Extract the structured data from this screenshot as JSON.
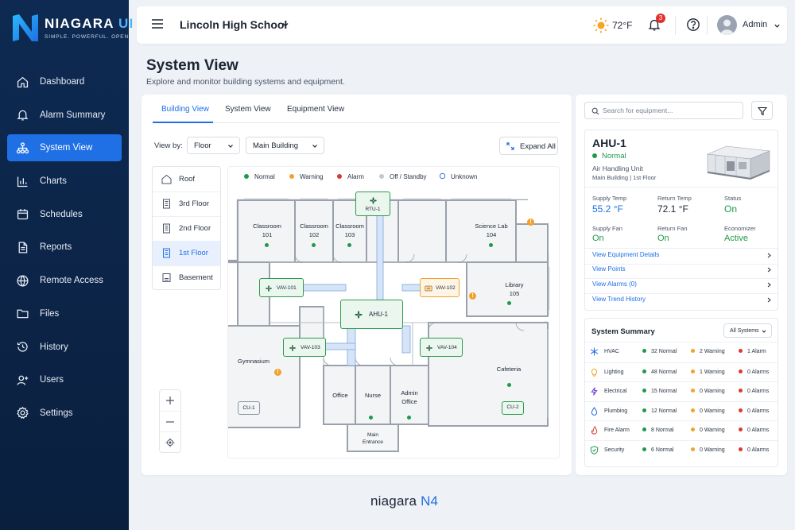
{
  "brand": {
    "name": "NIAGARA",
    "name_accent": "UI",
    "tagline": "SIMPLE. POWERFUL. OPEN."
  },
  "sidebar": {
    "items": [
      {
        "label": "Dashboard",
        "icon": "home-icon"
      },
      {
        "label": "Alarm Summary",
        "icon": "bell-icon"
      },
      {
        "label": "System View",
        "icon": "hierarchy-icon",
        "active": true
      },
      {
        "label": "Charts",
        "icon": "bar-chart-icon"
      },
      {
        "label": "Schedules",
        "icon": "calendar-icon"
      },
      {
        "label": "Reports",
        "icon": "document-icon"
      },
      {
        "label": "Remote Access",
        "icon": "globe-icon"
      },
      {
        "label": "Files",
        "icon": "folder-icon"
      },
      {
        "label": "History",
        "icon": "history-icon"
      },
      {
        "label": "Users",
        "icon": "add-user-icon"
      },
      {
        "label": "Settings",
        "icon": "gear-icon"
      }
    ]
  },
  "topbar": {
    "site": "Lincoln High School",
    "temperature": "72°F",
    "notifications": "3",
    "user": "Admin"
  },
  "page": {
    "title": "System View",
    "subtitle": "Explore and monitor building systems and equipment."
  },
  "tabs": [
    "Building View",
    "System View",
    "Equipment View"
  ],
  "controls": {
    "view_by_label": "View by:",
    "view_by_value": "Floor",
    "building_value": "Main Building",
    "expand_label": "Expand All"
  },
  "floors": [
    "Roof",
    "3rd Floor",
    "2nd Floor",
    "1st Floor",
    "Basement"
  ],
  "legend": [
    {
      "label": "Normal",
      "color": "#1e9a4a"
    },
    {
      "label": "Warning",
      "color": "#f2a22c"
    },
    {
      "label": "Alarm",
      "color": "#d93a2f"
    },
    {
      "label": "Off / Standby",
      "color": "#c2c7cf"
    },
    {
      "label": "Unknown",
      "color": "#2f6fd6"
    }
  ],
  "plan": {
    "rooms": [
      {
        "name": "Classroom",
        "num": "101"
      },
      {
        "name": "Classroom",
        "num": "102"
      },
      {
        "name": "Classroom",
        "num": "103"
      },
      {
        "name": "Science Lab",
        "num": "104"
      },
      {
        "name": "Library",
        "num": "105"
      },
      {
        "name": "Gymnasium",
        "num": ""
      },
      {
        "name": "Office",
        "num": ""
      },
      {
        "name": "Nurse",
        "num": ""
      },
      {
        "name": "Admin",
        "num": "Office"
      },
      {
        "name": "Cafeteria",
        "num": ""
      },
      {
        "name": "Main",
        "num": "Entrance"
      }
    ],
    "equipment": [
      "RTU-1",
      "VAV-101",
      "VAV-102",
      "AHU-1",
      "VAV-103",
      "VAV-104",
      "CU-1",
      "CU-2"
    ]
  },
  "search": {
    "placeholder": "Search for equipment..."
  },
  "equipment": {
    "name": "AHU-1",
    "status": "Normal",
    "type": "Air Handling Unit",
    "location": "Main Building  |  1st Floor",
    "metrics": [
      {
        "label": "Supply Temp",
        "value": "55.2 °F"
      },
      {
        "label": "Return Temp",
        "value": "72.1 °F"
      },
      {
        "label": "Status",
        "value": "On"
      },
      {
        "label": "Supply Fan",
        "value": "On"
      },
      {
        "label": "Return Fan",
        "value": "On"
      },
      {
        "label": "Economizer",
        "value": "Active"
      }
    ],
    "links": [
      "View Equipment Details",
      "View Points",
      "View Alarms (0)",
      "View Trend History"
    ]
  },
  "summary": {
    "title": "System Summary",
    "filter": "All Systems",
    "rows": [
      {
        "system": "HVAC",
        "icon": "snowflake-icon",
        "normal": "32 Normal",
        "warning": "2 Warning",
        "alarm": "1 Alarm"
      },
      {
        "system": "Lighting",
        "icon": "bulb-icon",
        "normal": "48 Normal",
        "warning": "1 Warning",
        "alarm": "0 Alarms"
      },
      {
        "system": "Electrical",
        "icon": "bolt-icon",
        "normal": "15 Normal",
        "warning": "0 Warning",
        "alarm": "0 Alarms"
      },
      {
        "system": "Plumbing",
        "icon": "drop-icon",
        "normal": "12 Normal",
        "warning": "0 Warning",
        "alarm": "0 Alarms"
      },
      {
        "system": "Fire Alarm",
        "icon": "flame-icon",
        "normal": "8 Normal",
        "warning": "0 Warning",
        "alarm": "0 Alarms"
      },
      {
        "system": "Security",
        "icon": "shield-icon",
        "normal": "6 Normal",
        "warning": "0 Warning",
        "alarm": "0 Alarms"
      }
    ]
  },
  "footer": {
    "brand": "niagara",
    "brand_accent": "N4"
  }
}
